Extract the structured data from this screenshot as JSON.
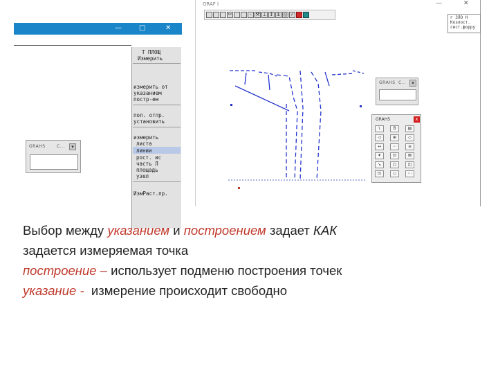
{
  "app_window": {
    "title": "GRAF I",
    "minimize": "—",
    "close": "✕",
    "toolbar_icons": [
      "new-icon",
      "save-icon",
      "print-icon",
      "scissors-icon",
      "copy-icon",
      "paste-icon",
      "dash-icon",
      "tool-icon",
      "measure-icon",
      "arrows-icon",
      "anchor-icon",
      "target-icon",
      "check-icon",
      "stop-icon",
      "monitor-icon"
    ],
    "right_info_lines": [
      "г ЗЛО Н",
      "Козлост.",
      "сист.форру"
    ]
  },
  "left_window": {
    "minimize": "—",
    "restore": "□",
    "close": "✕",
    "menu_items": [
      "Т ПЛОЩ",
      "Измерить",
      "измерить от",
      "указанием",
      "постр-ем",
      "пол. отпр.",
      "установить",
      "измерить",
      "листа",
      "линии",
      "рост. ис",
      "часть Л",
      "площадь",
      "узел",
      "ИзмРаст.пр."
    ]
  },
  "palettes": {
    "graphs_small_title": "GRAHS",
    "graphs_small_dots": "C...",
    "graphs_small_right_title": "GRAHS",
    "graphs_small_right_dots": "C..",
    "graphs_tool_title": "GRAHS",
    "graphs_tool_close": "x",
    "graphs_tool_buttons": [
      "\\",
      "B",
      "▤",
      "◁",
      "⊞",
      "◇",
      "↔",
      "⋯",
      "≡",
      "✦",
      "⊡",
      "⊠",
      "↘",
      "□",
      "◫",
      "⊡",
      "▭",
      "⋯"
    ]
  },
  "caption": {
    "line1_a": "Выбор между ",
    "line1_b": "указанием",
    "line1_c": " и ",
    "line1_d": "построением",
    "line1_e": " задает ",
    "line1_f": "КАК",
    "line2": "задается измеряемая точка",
    "line3_a": "построение –",
    "line3_b": " использует подменю построения точек",
    "line4_a": "указание -",
    "line4_b": "  измерение происходит свободно"
  },
  "colors": {
    "titlebar_blue": "#1a86c9",
    "drawing_blue": "#2233cc",
    "accent_red": "#c0392b"
  }
}
